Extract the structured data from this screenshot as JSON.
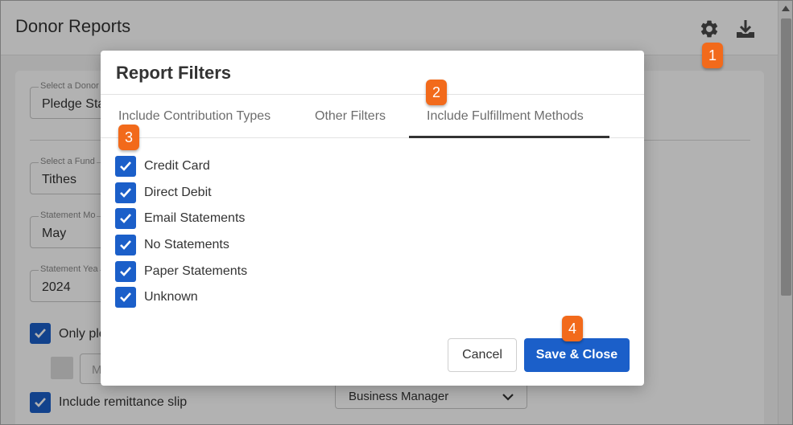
{
  "page": {
    "title": "Donor Reports",
    "fields": [
      {
        "label": "Select a Donor",
        "value": "Pledge Sta"
      },
      {
        "label": "Select a Fund",
        "value": "Tithes"
      },
      {
        "label": "Statement Mo",
        "value": "May"
      },
      {
        "label": "Statement Yea",
        "value": "2024"
      }
    ],
    "checkbox_pledges_label": "Only ple",
    "small_field_placeholder": "M",
    "checkbox_remittance_label": "Include remittance slip",
    "select_value": "Business Manager"
  },
  "modal": {
    "title": "Report Filters",
    "tabs": [
      {
        "label": "Include Contribution Types",
        "active": false
      },
      {
        "label": "Other Filters",
        "active": false
      },
      {
        "label": "Include Fulfillment Methods",
        "active": true
      }
    ],
    "options": [
      {
        "label": "Credit Card",
        "checked": true
      },
      {
        "label": "Direct Debit",
        "checked": true
      },
      {
        "label": "Email Statements",
        "checked": true
      },
      {
        "label": "No Statements",
        "checked": true
      },
      {
        "label": "Paper Statements",
        "checked": true
      },
      {
        "label": "Unknown",
        "checked": true
      }
    ],
    "cancel_label": "Cancel",
    "save_label": "Save & Close"
  },
  "callouts": [
    "1",
    "2",
    "3",
    "4"
  ],
  "colors": {
    "accent": "#1b5fc9",
    "callout": "#f26a1b"
  },
  "icons": {
    "settings": "gear-icon",
    "download": "download-icon",
    "check": "checkmark-icon",
    "dropdown": "chevron-down-icon"
  }
}
